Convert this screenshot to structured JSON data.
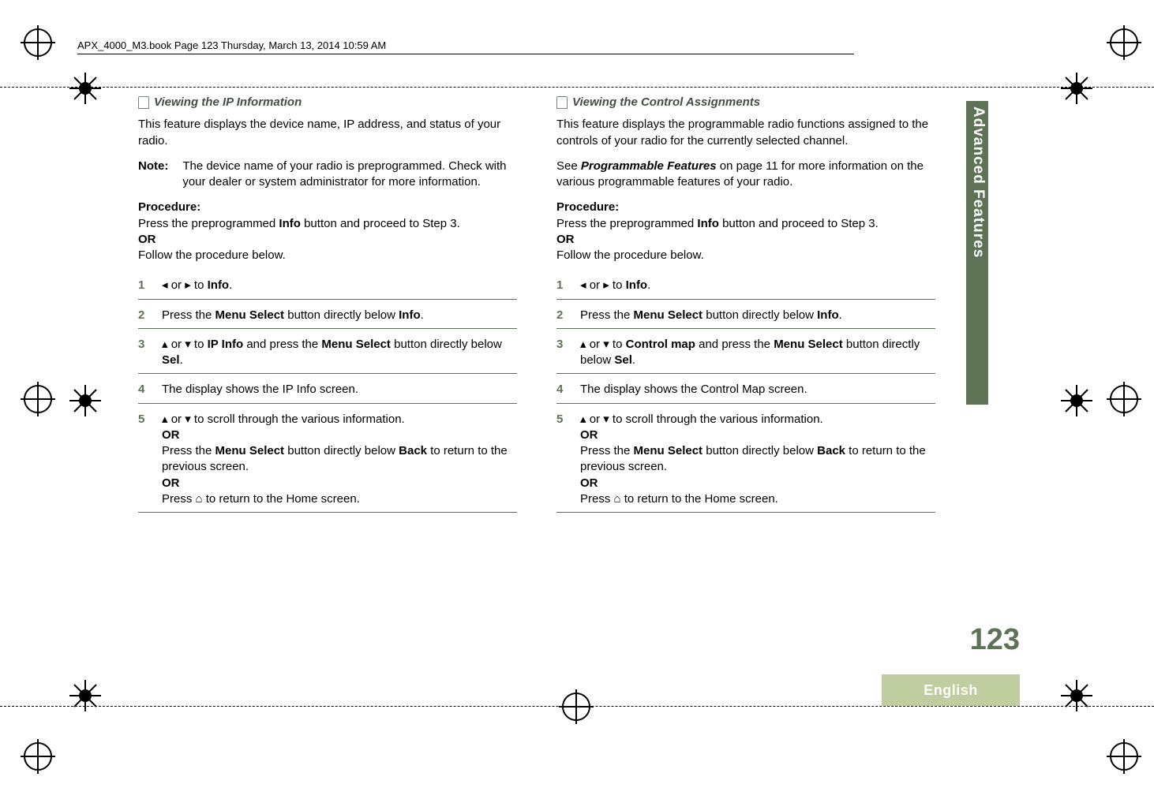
{
  "header_text": "APX_4000_M3.book  Page 123  Thursday, March 13, 2014  10:59 AM",
  "sidebar_title": "Advanced Features",
  "page_number": "123",
  "language": "English",
  "glyphs": {
    "left": "◂",
    "right": "▸",
    "up": "▴",
    "down": "▾",
    "home": "⌂"
  },
  "left": {
    "title": "Viewing the IP Information",
    "intro": "This feature displays the device name, IP address, and status of your radio.",
    "note_label": "Note:",
    "note_text": "The device name of your radio is preprogrammed. Check with your dealer or system administrator for more information.",
    "proc_label": "Procedure:",
    "proc_line1_a": "Press the preprogrammed ",
    "proc_line1_b": "Info",
    "proc_line1_c": " button and proceed to Step 3.",
    "or": "OR",
    "proc_line2": "Follow the procedure below.",
    "steps": {
      "s1": {
        "num": "1",
        "a": " or ",
        "b": " to ",
        "ui": "Info",
        "c": "."
      },
      "s2": {
        "num": "2",
        "a": "Press the ",
        "b": "Menu Select",
        "c": " button directly below ",
        "ui": "Info",
        "d": "."
      },
      "s3": {
        "num": "3",
        "a": " or ",
        "b": " to ",
        "ui1": "IP Info",
        "c": " and press the ",
        "d": "Menu Select",
        "e": " button directly below ",
        "ui2": "Sel",
        "f": "."
      },
      "s4": {
        "num": "4",
        "a": "The display shows the IP Info screen."
      },
      "s5": {
        "num": "5",
        "a": " or ",
        "b": " to scroll through the various information.",
        "or1": "OR",
        "c": "Press the ",
        "d": "Menu Select",
        "e": " button directly below ",
        "ui": "Back",
        "f": " to return to the previous screen.",
        "or2": "OR",
        "g": "Press ",
        "h": " to return to the Home screen."
      }
    }
  },
  "right": {
    "title": "Viewing the Control Assignments",
    "intro": "This feature displays the programmable radio functions assigned to the controls of your radio for the currently selected channel.",
    "see_a": "See ",
    "see_b": "Programmable Features",
    "see_c": " on page 11 for more information on the various programmable features of your radio.",
    "proc_label": "Procedure:",
    "proc_line1_a": "Press the preprogrammed ",
    "proc_line1_b": "Info",
    "proc_line1_c": " button and proceed to Step 3.",
    "or": "OR",
    "proc_line2": "Follow the procedure below.",
    "steps": {
      "s1": {
        "num": "1",
        "a": " or ",
        "b": " to ",
        "ui": "Info",
        "c": "."
      },
      "s2": {
        "num": "2",
        "a": "Press the ",
        "b": "Menu Select",
        "c": " button directly below ",
        "ui": "Info",
        "d": "."
      },
      "s3": {
        "num": "3",
        "a": " or ",
        "b": " to ",
        "ui1": "Control map",
        "c": " and press the ",
        "d": "Menu Select",
        "e": " button directly below ",
        "ui2": "Sel",
        "f": "."
      },
      "s4": {
        "num": "4",
        "a": "The display shows the Control Map screen."
      },
      "s5": {
        "num": "5",
        "a": " or ",
        "b": " to scroll through the various information.",
        "or1": "OR",
        "c": "Press the ",
        "d": "Menu Select",
        "e": " button directly below ",
        "ui": "Back",
        "f": " to return to the previous screen.",
        "or2": "OR",
        "g": "Press ",
        "h": " to return to the Home screen."
      }
    }
  }
}
